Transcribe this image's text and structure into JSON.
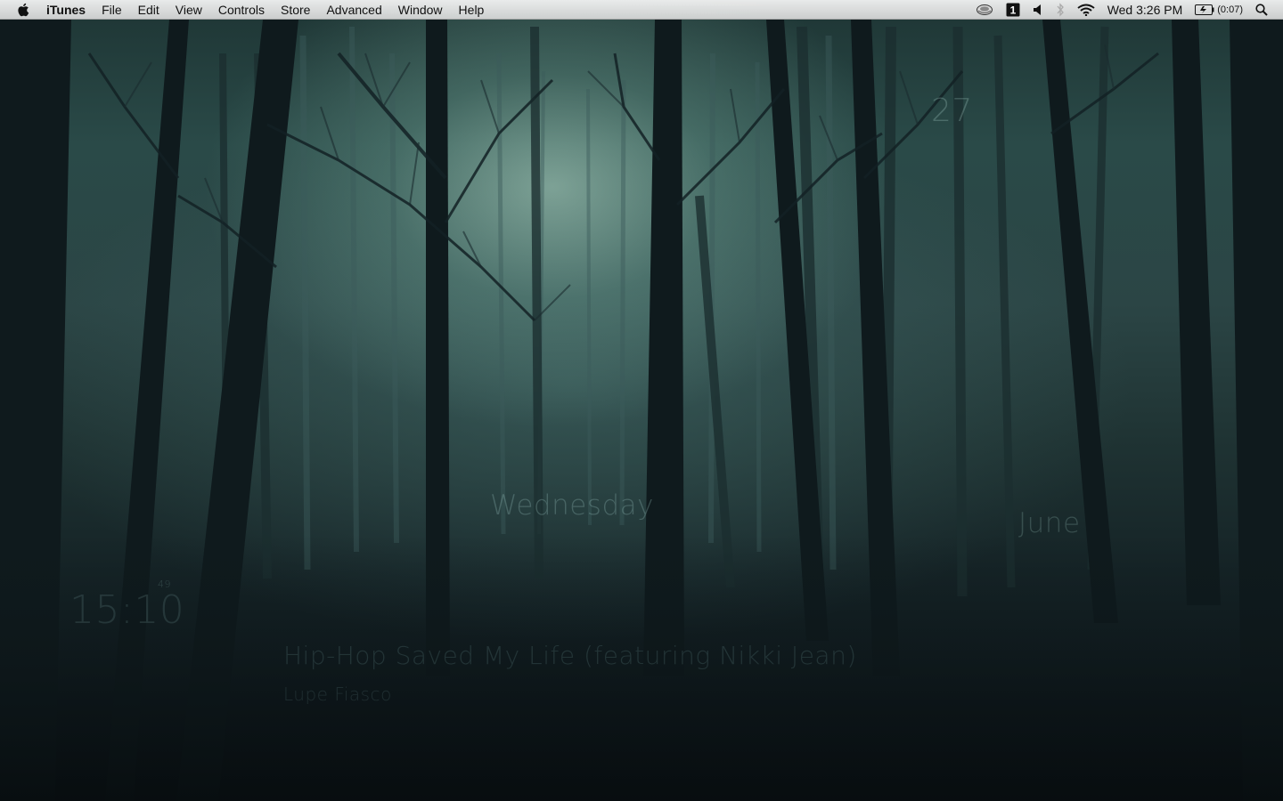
{
  "menubar": {
    "apple_icon": "apple-logo-icon",
    "app_name": "iTunes",
    "items": [
      "File",
      "Edit",
      "View",
      "Controls",
      "Store",
      "Advanced",
      "Window",
      "Help"
    ],
    "status": {
      "time_machine_icon": "time-machine-icon",
      "badge_value": "1",
      "volume_icon": "speaker-icon",
      "bluetooth_icon": "bluetooth-icon",
      "wifi_icon": "wifi-icon",
      "clock": "Wed 3:26 PM",
      "battery_icon": "battery-charging-icon",
      "battery_text": "(0:07)",
      "spotlight_icon": "magnifier-icon"
    }
  },
  "widgets": {
    "day_of_month": "27",
    "weekday": "Wednesday",
    "month": "June",
    "clock_time": "15:10",
    "clock_seconds": "49",
    "now_playing_title": "Hip-Hop Saved My Life (featuring Nikki Jean)",
    "now_playing_artist": "Lupe Fiasco"
  },
  "colors": {
    "fog_highlight": "#bfe3d3",
    "forest_dark": "#0b1317",
    "menubar": "#eeeeee"
  }
}
